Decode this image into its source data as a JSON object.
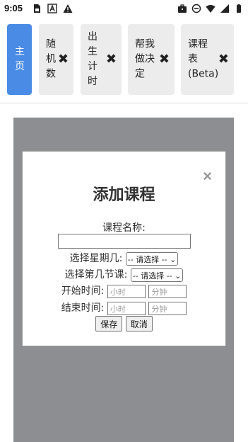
{
  "status_bar": {
    "time": "9:05",
    "left_icons": [
      "sim-card-icon",
      "font-a-icon",
      "warning-icon"
    ],
    "right_icons": [
      "briefcase-icon",
      "dnd-icon",
      "wifi-icon",
      "signal-icon",
      "battery-icon"
    ]
  },
  "tabs": [
    {
      "label": "主\n页",
      "active": true,
      "closable": false
    },
    {
      "label": "随\n机\n数",
      "active": false,
      "closable": true
    },
    {
      "label": "出\n生\n计\n时",
      "active": false,
      "closable": true
    },
    {
      "label": "帮我\n做决\n定",
      "active": false,
      "closable": true
    },
    {
      "label": "课程\n表\n(Beta)",
      "active": false,
      "closable": true
    }
  ],
  "modal": {
    "close_glyph": "×",
    "title": "添加课程",
    "course_name_label": "课程名称:",
    "course_name_value": "",
    "weekday_label": "选择星期几:",
    "weekday_selected": "-- 请选择 --",
    "period_label": "选择第几节课:",
    "period_selected": "-- 请选择 --",
    "start_label": "开始时间:",
    "end_label": "结束时间:",
    "hour_placeholder": "小时",
    "minute_placeholder": "分钟",
    "save_label": "保存",
    "cancel_label": "取消"
  },
  "colors": {
    "active_tab": "#4a8be6",
    "inactive_tab": "#ececec",
    "overlay": "#8c8e92"
  }
}
